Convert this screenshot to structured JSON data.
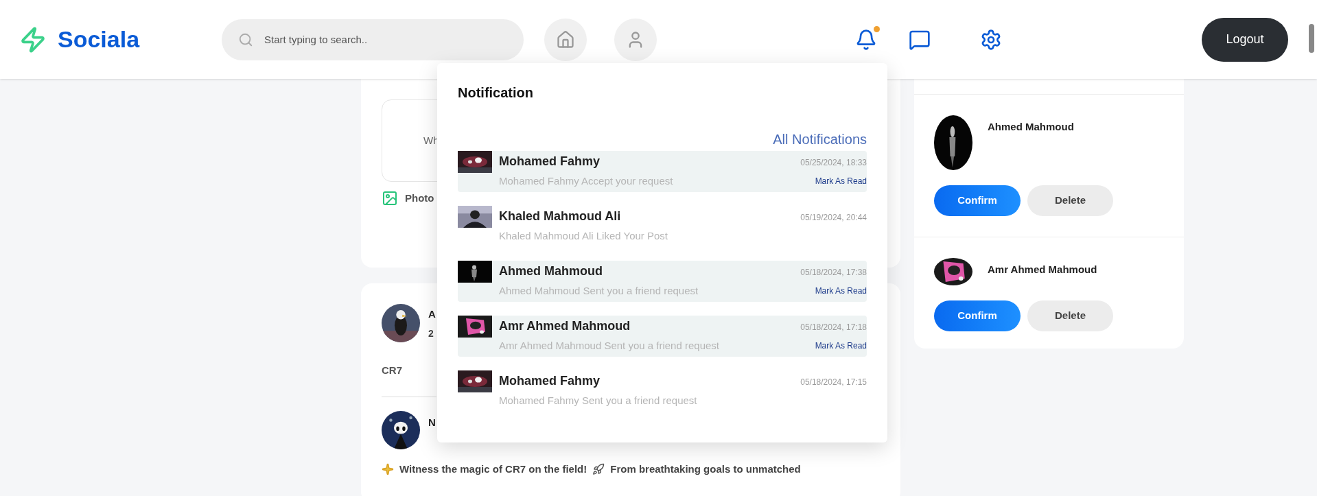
{
  "brand": {
    "name": "Sociala"
  },
  "search": {
    "placeholder": "Start typing to search.."
  },
  "nav": {
    "notifications_badge": true
  },
  "logout": "Logout",
  "composer": {
    "prompt_fragment": "Wh",
    "photo_label": "Photo"
  },
  "posts": [
    {
      "author_fragment": "A",
      "time_fragment": "2",
      "text": "CR7"
    },
    {
      "author_fragment": "N",
      "text_parts": [
        "Witness the magic of CR7 on the field!",
        "From breathtaking goals to unmatched"
      ]
    }
  ],
  "notifications": {
    "title": "Notification",
    "all_link": "All Notifications",
    "items": [
      {
        "name": "Mohamed Fahmy",
        "message": "Mohamed Fahmy Accept your request",
        "time": "05/25/2024, 18:33",
        "read": false,
        "action": "Mark As Read"
      },
      {
        "name": "Khaled Mahmoud Ali",
        "message": "Khaled Mahmoud Ali Liked Your Post",
        "time": "05/19/2024, 20:44",
        "read": true
      },
      {
        "name": "Ahmed Mahmoud",
        "message": "Ahmed Mahmoud Sent you a friend request",
        "time": "05/18/2024, 17:38",
        "read": false,
        "action": "Mark As Read"
      },
      {
        "name": "Amr Ahmed Mahmoud",
        "message": "Amr Ahmed Mahmoud Sent you a friend request",
        "time": "05/18/2024, 17:18",
        "read": false,
        "action": "Mark As Read"
      },
      {
        "name": "Mohamed Fahmy",
        "message": "Mohamed Fahmy Sent you a friend request",
        "time": "05/18/2024, 17:15",
        "read": true
      }
    ]
  },
  "friend_requests": [
    {
      "name": "Ahmed Mahmoud",
      "confirm": "Confirm",
      "delete": "Delete"
    },
    {
      "name": "Amr Ahmed Mahmoud",
      "confirm": "Confirm",
      "delete": "Delete"
    }
  ]
}
